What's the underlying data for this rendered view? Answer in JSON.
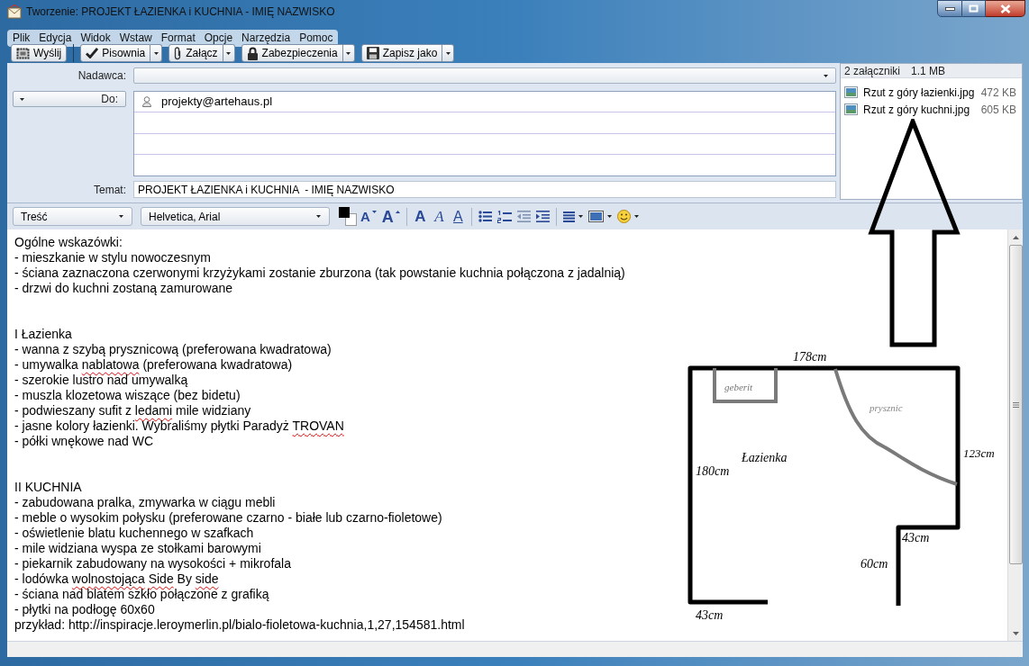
{
  "window": {
    "title": "Tworzenie: PROJEKT ŁAZIENKA i KUCHNIA - IMIĘ NAZWISKO"
  },
  "menu": [
    "Plik",
    "Edycja",
    "Widok",
    "Wstaw",
    "Format",
    "Opcje",
    "Narzędzia",
    "Pomoc"
  ],
  "toolbar": [
    [
      {
        "kind": "send",
        "label": "Wyślij",
        "dropdown": false
      }
    ],
    [
      {
        "kind": "spelling",
        "label": "Pisownia",
        "dropdown": true
      },
      {
        "kind": "attach",
        "label": "Załącz",
        "dropdown": true
      },
      {
        "kind": "security",
        "label": "Zabezpieczenia",
        "dropdown": true
      },
      {
        "kind": "save",
        "label": "Zapisz jako",
        "dropdown": true
      }
    ]
  ],
  "header": {
    "from_label": "Nadawca:",
    "to_label": "Do:",
    "recipients": [
      {
        "address": "projekty@artehaus.pl"
      }
    ],
    "subject_label": "Temat:",
    "subject": "PROJEKT ŁAZIENKA i KUCHNIA  - IMIĘ NAZWISKO"
  },
  "attachments": {
    "count_label": "2 załączniki",
    "total_size": "1.1 MB",
    "files": [
      {
        "name": "Rzut z góry łazienki.jpg",
        "size": "472 KB"
      },
      {
        "name": "Rzut z góry kuchni.jpg",
        "size": "605 KB"
      }
    ]
  },
  "format_toolbar": {
    "paragraph_style": "Treść",
    "font": "Helvetica, Arial",
    "button_groups": [
      [
        {
          "kind": "text-color",
          "dropdown": false
        },
        {
          "kind": "font-smaller",
          "glyph": "A",
          "dropdown": false
        },
        {
          "kind": "font-larger",
          "glyph": "A",
          "dropdown": false
        }
      ],
      [
        {
          "kind": "bold",
          "glyph": "A",
          "dropdown": false
        },
        {
          "kind": "italic",
          "glyph": "A",
          "dropdown": false
        },
        {
          "kind": "underline",
          "glyph": "A",
          "dropdown": false
        }
      ],
      [
        {
          "kind": "bullet-list",
          "dropdown": false
        },
        {
          "kind": "numbered-list",
          "dropdown": false
        },
        {
          "kind": "outdent",
          "dropdown": false
        },
        {
          "kind": "indent",
          "dropdown": false
        }
      ],
      [
        {
          "kind": "align",
          "dropdown": true
        },
        {
          "kind": "background-color",
          "dropdown": true
        },
        {
          "kind": "emoji",
          "dropdown": true
        }
      ]
    ]
  },
  "body": {
    "sections": [
      {
        "lines": [
          {
            "text": "Ogólne wskazówki:"
          },
          {
            "text": "- mieszkanie w stylu nowoczesnym"
          },
          {
            "text": "- ściana zaznaczona czerwonymi krzyżykami zostanie zburzona (tak powstanie kuchnia połączona z jadalnią)"
          },
          {
            "text": "- drzwi do kuchni zostaną zamurowane"
          }
        ]
      },
      {
        "lines": [
          {
            "text": "I Łazienka"
          },
          {
            "text": "- wanna z szybą prysznicową (preferowana kwadratowa)"
          },
          {
            "words": [
              {
                "text": "- umywalka",
                "misspelled": false
              },
              {
                "text": "nablatowa",
                "misspelled": true
              },
              {
                "text": "(preferowana kwadratowa)",
                "misspelled": false
              }
            ]
          },
          {
            "text": "- szerokie lustro nad umywalką"
          },
          {
            "text": "- muszla klozetowa wiszące (bez bidetu)"
          },
          {
            "words": [
              {
                "text": "- podwieszany sufit z",
                "misspelled": false
              },
              {
                "text": "ledami",
                "misspelled": true
              },
              {
                "text": "mile widziany",
                "misspelled": false
              }
            ]
          },
          {
            "words": [
              {
                "text": "- jasne kolory łazienki. Wybraliśmy płytki Paradyż",
                "misspelled": false
              },
              {
                "text": "TROVAN",
                "misspelled": true
              }
            ]
          },
          {
            "text": "- półki wnękowe nad WC"
          }
        ]
      },
      {
        "lines": [
          {
            "text": "II KUCHNIA"
          },
          {
            "text": "- zabudowana pralka, zmywarka w ciągu mebli"
          },
          {
            "text": "- meble o wysokim połysku (preferowane czarno - białe lub czarno-fioletowe)"
          },
          {
            "text": "- oświetlenie blatu kuchennego w szafkach"
          },
          {
            "text": "- mile widziana wyspa ze stołkami barowymi"
          },
          {
            "text": "- piekarnik zabudowany na wysokości + mikrofala"
          },
          {
            "words": [
              {
                "text": "- lodówka",
                "misspelled": false
              },
              {
                "text": "wolnostojąca",
                "misspelled": true
              },
              {
                "text": "Side",
                "misspelled": true
              },
              {
                "text": "By",
                "misspelled": false
              },
              {
                "text": "side",
                "misspelled": true
              }
            ]
          },
          {
            "text": "- ściana nad blatem szkło połączone z grafiką"
          },
          {
            "text": "- płytki na podłogę 60x60"
          },
          {
            "text": "przykład: http://inspiracje.leroymerlin.pl/bialo-fioletowa-kuchnia,1,27,154581.html"
          }
        ]
      }
    ]
  },
  "floor_plan": {
    "top_width": "178cm",
    "toilet_label": "geberit",
    "shower_label": "prysznic",
    "room_label": "Łazienka",
    "left_height": "180cm",
    "right_height": "123cm",
    "step_width": "43cm",
    "step_height": "60cm",
    "bottom_width": "43cm"
  }
}
